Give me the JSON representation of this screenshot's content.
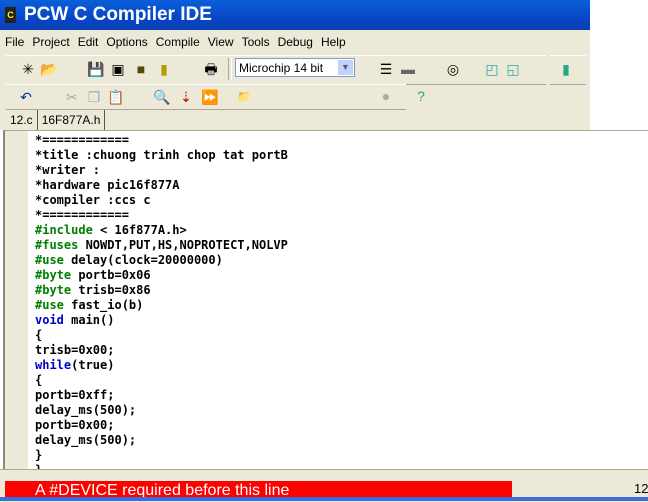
{
  "title": "PCW C Compiler IDE",
  "menu": [
    "File",
    "Project",
    "Edit",
    "Options",
    "Compile",
    "View",
    "Tools",
    "Debug",
    "Help"
  ],
  "toolbar": {
    "device_select": "Microchip 14 bit"
  },
  "tabs": [
    "12.c",
    "16F877A.h"
  ],
  "code": [
    {
      "t": "*============"
    },
    {
      "t": "*title :chuong trinh chop tat portB"
    },
    {
      "t": "*writer :"
    },
    {
      "t": "*hardware pic16f877A"
    },
    {
      "t": "*compiler :ccs c"
    },
    {
      "t": "*============"
    },
    {
      "k": "#include",
      "t": " < 16f877A.h>",
      "c": "pp"
    },
    {
      "k": "#fuses",
      "t": " NOWDT,PUT,HS,NOPROTECT,NOLVP",
      "c": "pp"
    },
    {
      "k": "#use",
      "t": " delay(clock=20000000)",
      "c": "pp"
    },
    {
      "k": "#byte",
      "t": " portb=0x06",
      "c": "pp"
    },
    {
      "k": "#byte",
      "t": " trisb=0x86",
      "c": "pp"
    },
    {
      "k": "#use",
      "t": " fast_io(b)",
      "c": "pp"
    },
    {
      "k": "void",
      "t": " main()",
      "c": "kw"
    },
    {
      "t": "{"
    },
    {
      "t": "trisb=0x00;"
    },
    {
      "k": "while",
      "t": "(true)",
      "c": "kw"
    },
    {
      "t": "{"
    },
    {
      "t": "portb=0xff;"
    },
    {
      "t": "delay_ms(500);"
    },
    {
      "t": "portb=0x00;"
    },
    {
      "t": "delay_ms(500);"
    },
    {
      "t": "}"
    },
    {
      "t": "}"
    }
  ],
  "status": {
    "error": "A #DEVICE required before this line",
    "position": "12"
  }
}
